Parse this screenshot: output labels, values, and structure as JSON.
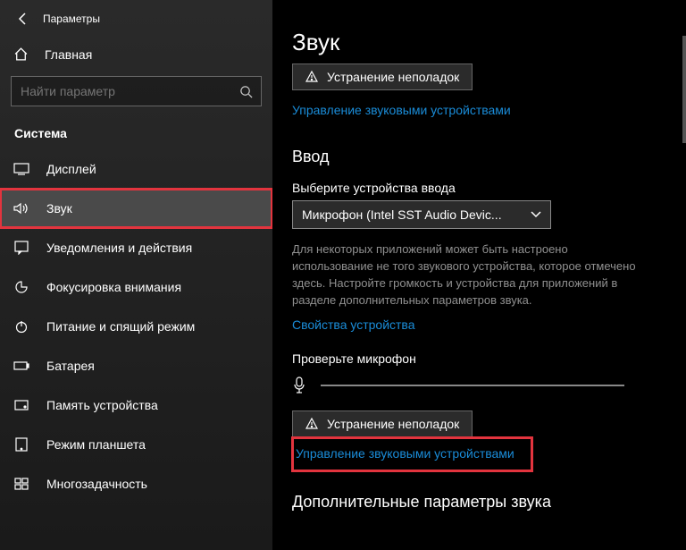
{
  "titlebar": {
    "title": "Параметры"
  },
  "home": {
    "label": "Главная"
  },
  "search": {
    "placeholder": "Найти параметр"
  },
  "section": {
    "label": "Система"
  },
  "nav": {
    "items": [
      {
        "label": "Дисплей"
      },
      {
        "label": "Звук"
      },
      {
        "label": "Уведомления и действия"
      },
      {
        "label": "Фокусировка внимания"
      },
      {
        "label": "Питание и спящий режим"
      },
      {
        "label": "Батарея"
      },
      {
        "label": "Память устройства"
      },
      {
        "label": "Режим планшета"
      },
      {
        "label": "Многозадачность"
      }
    ]
  },
  "main": {
    "title": "Звук",
    "troubleshoot1": "Устранение неполадок",
    "manage_devices1": "Управление звуковыми устройствами",
    "input_heading": "Ввод",
    "input_select_label": "Выберите устройства ввода",
    "input_device": "Микрофон (Intel SST Audio Devic...",
    "input_desc": "Для некоторых приложений может быть настроено использование не того звукового устройства, которое отмечено здесь. Настройте громкость и устройства для приложений в разделе дополнительных параметров звука.",
    "device_props": "Свойства устройства",
    "test_mic": "Проверьте микрофон",
    "troubleshoot2": "Устранение неполадок",
    "manage_devices2": "Управление звуковыми устройствами",
    "additional": "Дополнительные параметры звука"
  }
}
